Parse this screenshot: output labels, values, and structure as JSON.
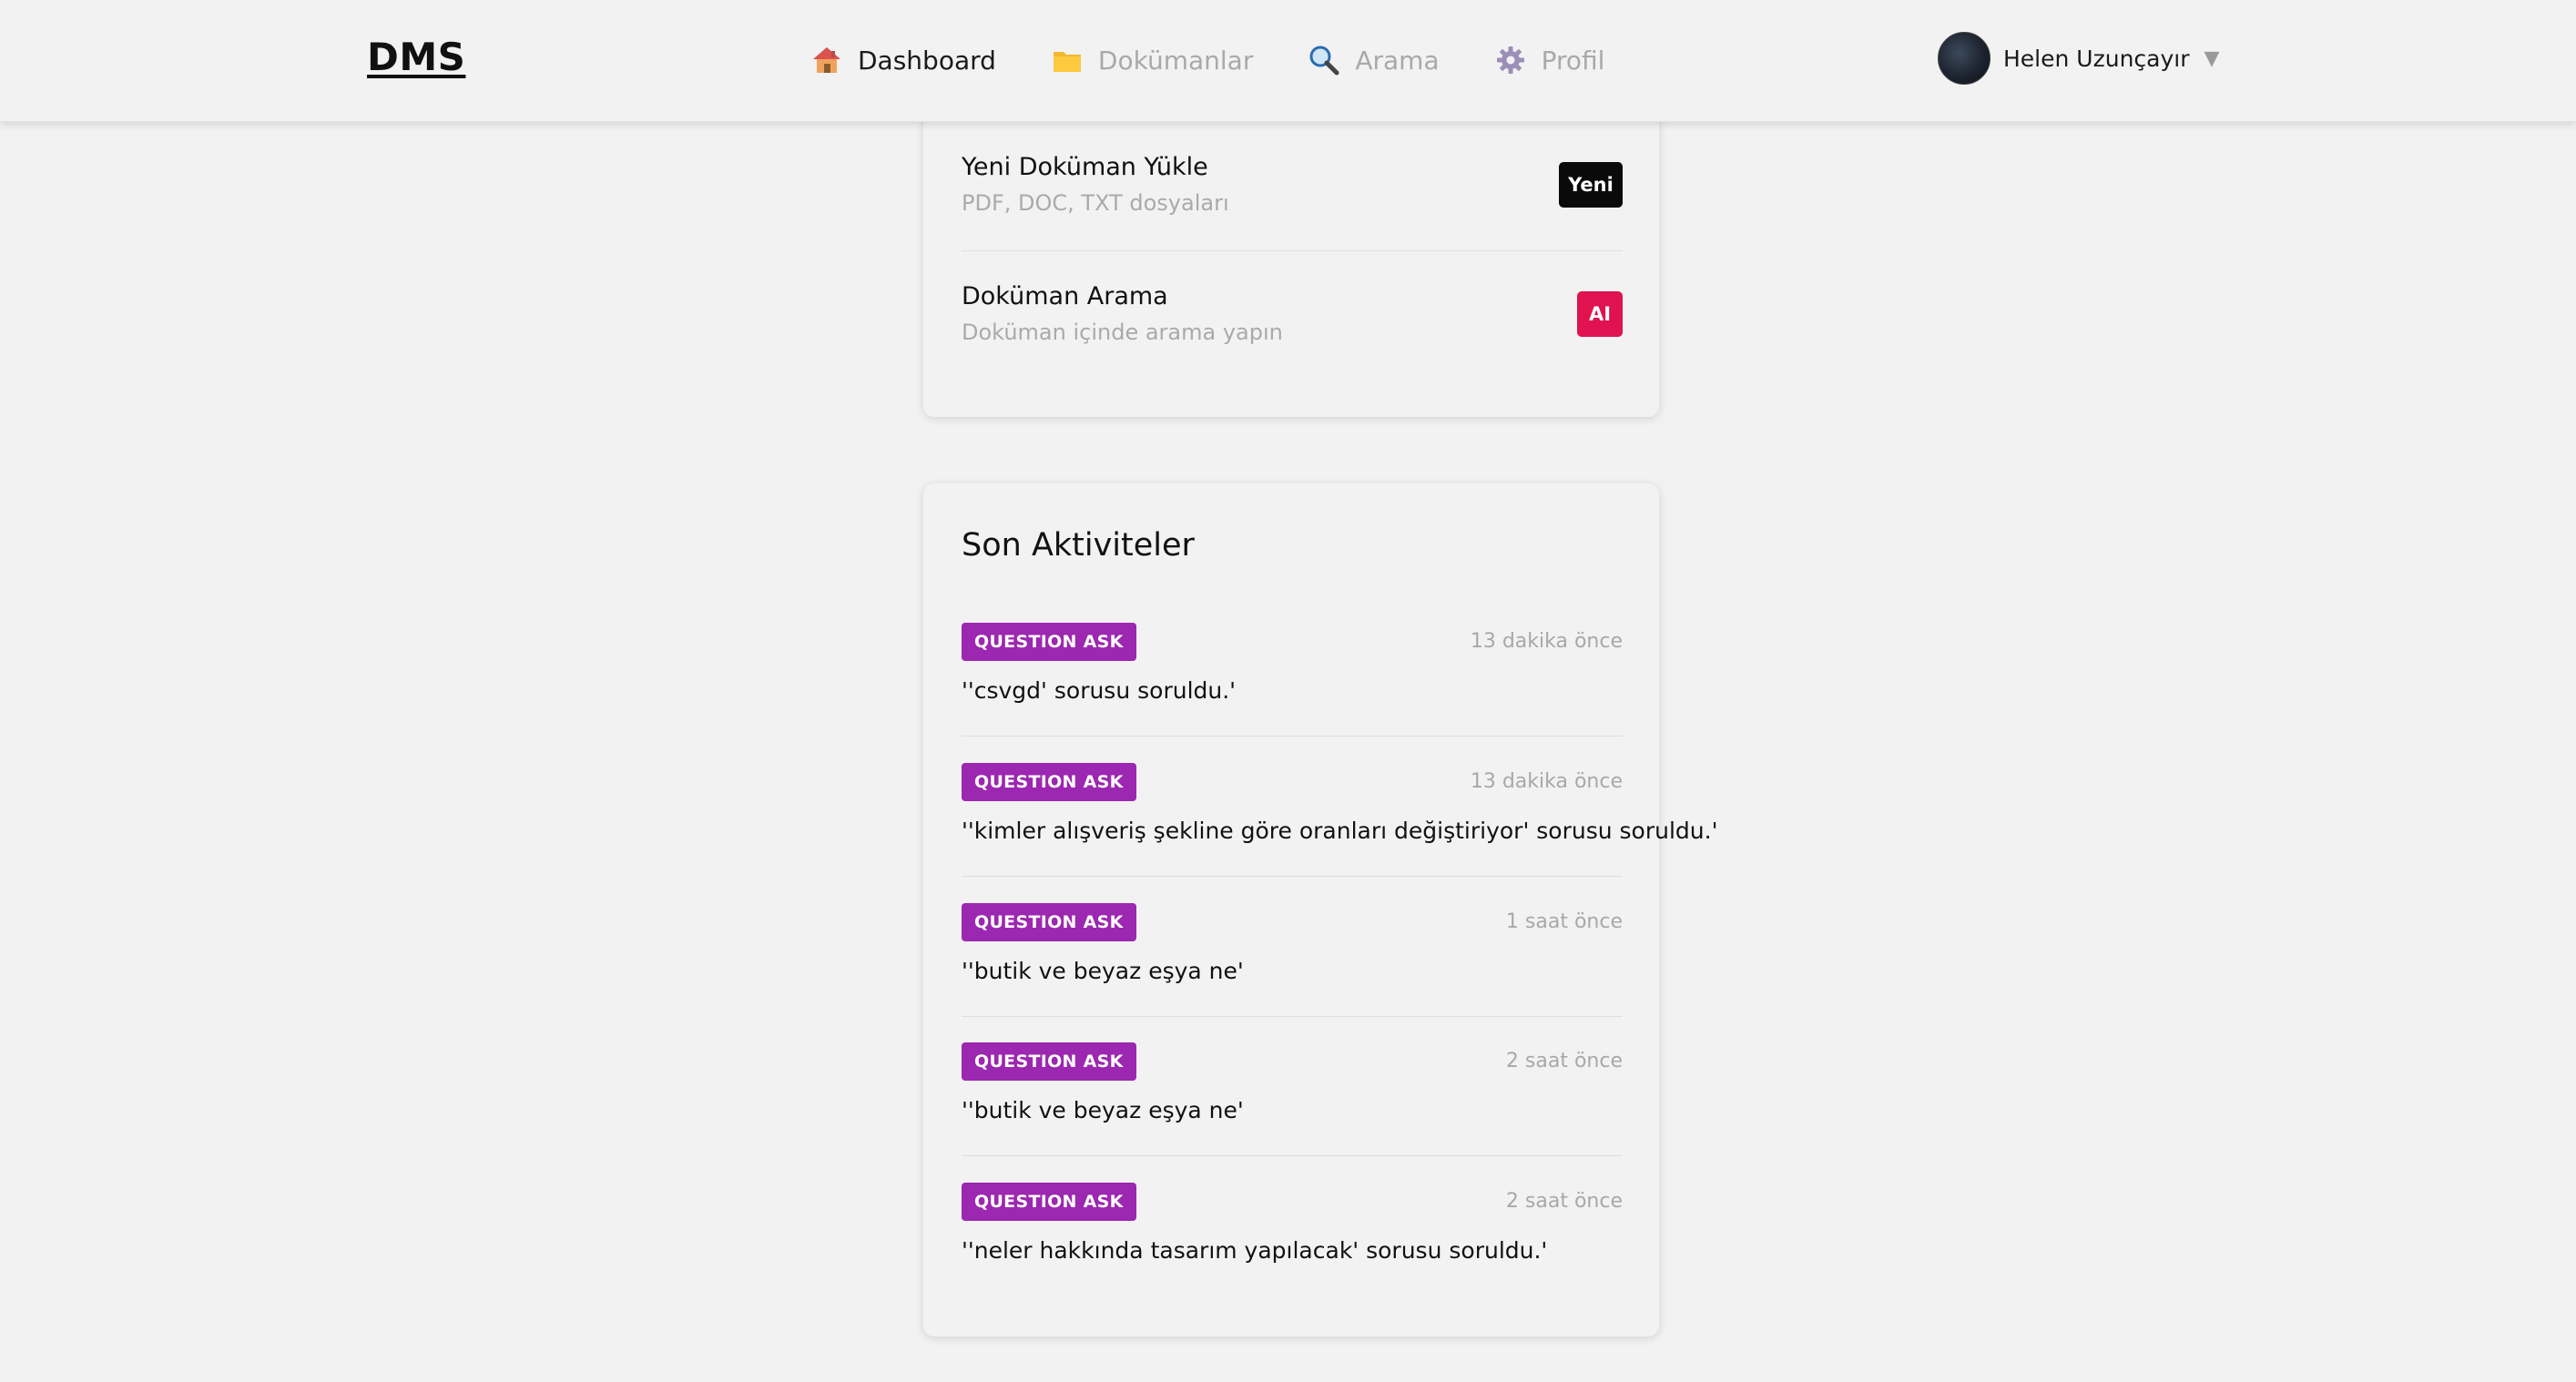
{
  "app": {
    "logo": "DMS"
  },
  "nav": {
    "items": [
      {
        "label": "Dashboard",
        "icon": "house-icon",
        "active": true
      },
      {
        "label": "Dokümanlar",
        "icon": "folder-icon",
        "active": false
      },
      {
        "label": "Arama",
        "icon": "magnifier-icon",
        "active": false
      },
      {
        "label": "Profil",
        "icon": "gear-icon",
        "active": false
      }
    ]
  },
  "user": {
    "name": "Helen Uzunçayır",
    "caret": "▼"
  },
  "actions": [
    {
      "title": "Yeni Doküman Yükle",
      "subtitle": "PDF, DOC, TXT dosyaları",
      "badge": "Yeni",
      "badge_color": "#0a0a0a"
    },
    {
      "title": "Doküman Arama",
      "subtitle": "Doküman içinde arama yapın",
      "badge": "AI",
      "badge_color": "#e0124f"
    }
  ],
  "activity": {
    "heading": "Son Aktiviteler",
    "tag_color": "#9c27b0",
    "items": [
      {
        "tag": "QUESTION ASK",
        "time": "13 dakika önce",
        "message": "''csvgd' sorusu soruldu.'"
      },
      {
        "tag": "QUESTION ASK",
        "time": "13 dakika önce",
        "message": "''kimler alışveriş şekline göre oranları değiştiriyor' sorusu soruldu.'"
      },
      {
        "tag": "QUESTION ASK",
        "time": "1 saat önce",
        "message": "''butik ve beyaz eşya ne'"
      },
      {
        "tag": "QUESTION ASK",
        "time": "2 saat önce",
        "message": "''butik ve beyaz eşya ne'"
      },
      {
        "tag": "QUESTION ASK",
        "time": "2 saat önce",
        "message": "''neler hakkında tasarım yapılacak' sorusu soruldu.'"
      }
    ]
  }
}
